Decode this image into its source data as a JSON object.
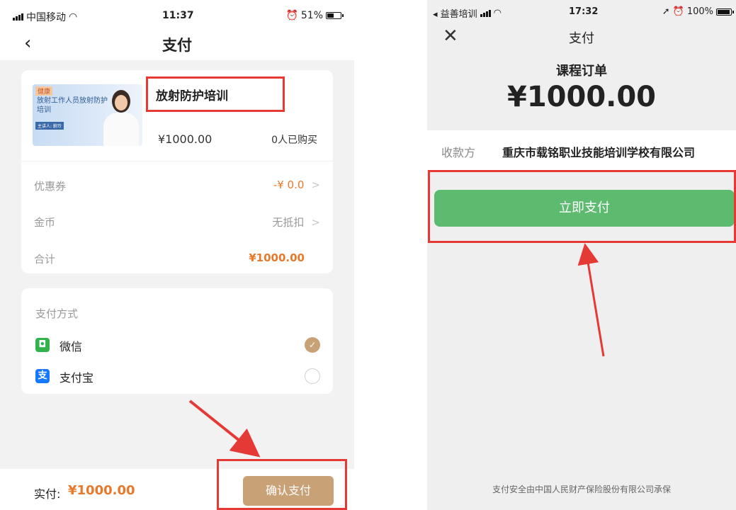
{
  "left": {
    "status": {
      "carrier": "中国移动",
      "time": "11:37",
      "battery": "51%"
    },
    "nav": {
      "back_icon": "chevron-left-icon",
      "title": "支付"
    },
    "product": {
      "thumb_tag": "健康",
      "thumb_title": "放射工作人员放射防护培训",
      "thumb_host": "主讲人: 蔚玲",
      "name": "放射防护培训",
      "price": "¥1000.00",
      "buyers": "0人已购买"
    },
    "rows": [
      {
        "label": "优惠券",
        "value": "-¥ 0.0",
        "chevron": ">"
      },
      {
        "label": "金币",
        "value": "无抵扣",
        "chevron": ">"
      },
      {
        "label": "合计",
        "value": "¥1000.00",
        "chevron": ""
      }
    ],
    "payment": {
      "title": "支付方式",
      "methods": [
        {
          "name": "微信",
          "icon": "wechat-icon",
          "icon_glyph": "◘",
          "checked": true
        },
        {
          "name": "支付宝",
          "icon": "alipay-icon",
          "icon_glyph": "支",
          "checked": false
        }
      ],
      "check_glyph": "✓"
    },
    "bottom": {
      "pay_label": "实付:",
      "pay_amount": "¥1000.00",
      "confirm_label": "确认支付"
    }
  },
  "right": {
    "status": {
      "back_app": "◂ 益善培训",
      "time": "17:32",
      "battery": "100%"
    },
    "nav": {
      "close_icon": "close-icon",
      "close_glyph": "✕",
      "title": "支付"
    },
    "order": {
      "label": "课程订单",
      "amount": "¥1000.00"
    },
    "payee": {
      "label": "收款方",
      "value": "重庆市载铭职业技能培训学校有限公司"
    },
    "pay_now_label": "立即支付",
    "guarantee": "支付安全由中国人民财产保险股份有限公司承保"
  },
  "colors": {
    "accent_gold": "#c9a176",
    "price_orange": "#e8792a",
    "wechat_green": "#5dbb6f",
    "annotation_red": "#e53935"
  }
}
